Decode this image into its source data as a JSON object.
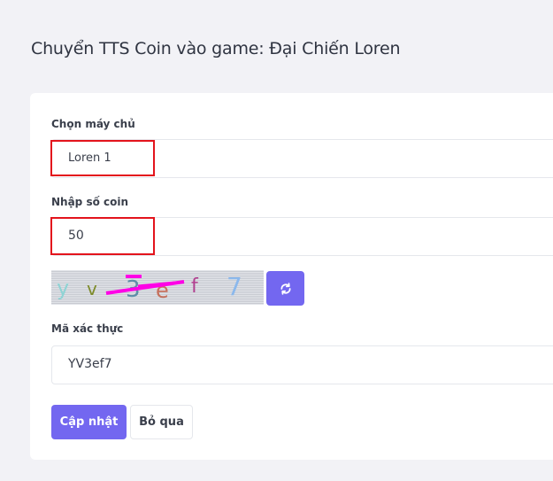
{
  "page": {
    "title": "Chuyển TTS Coin vào game: Đại Chiến Loren"
  },
  "form": {
    "server": {
      "label": "Chọn máy chủ",
      "value": "Loren 1"
    },
    "coin": {
      "label": "Nhập số coin",
      "value": "50"
    },
    "captcha": {
      "chars": [
        {
          "ch": "y",
          "color": "#8fd3d4"
        },
        {
          "ch": "v",
          "color": "#7d8b2a"
        },
        {
          "ch": "3",
          "color": "#5e8ea8"
        },
        {
          "ch": "e",
          "color": "#c56f5b"
        },
        {
          "ch": "f",
          "color": "#b13f8f"
        },
        {
          "ch": "7",
          "color": "#8bb8ec"
        }
      ],
      "strike_color": "#ff00e6",
      "refresh_icon": "refresh-icon"
    },
    "verify": {
      "label": "Mã xác thực",
      "value": "YV3ef7"
    }
  },
  "buttons": {
    "update": "Cập nhật",
    "skip": "Bỏ qua"
  },
  "colors": {
    "accent": "#7367f0",
    "highlight": "#e3141c",
    "background": "#f2f2f6"
  }
}
